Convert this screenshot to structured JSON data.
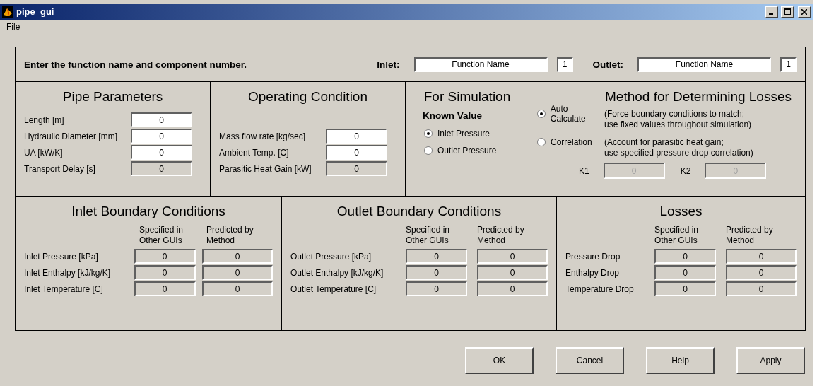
{
  "window": {
    "title": "pipe_gui"
  },
  "menu": [
    "File"
  ],
  "header": {
    "prompt": "Enter the function name and component number.",
    "ports": [
      {
        "label": "Inlet:",
        "function": "Function Name",
        "number": "1"
      },
      {
        "label": "Outlet:",
        "function": "Function Name",
        "number": "1"
      }
    ]
  },
  "pipe_parameters": {
    "title": "Pipe Parameters",
    "fields": [
      {
        "label": "Length [m]",
        "value": "0",
        "kind": "editable"
      },
      {
        "label": "Hydraulic Diameter [mm]",
        "value": "0",
        "kind": "editable"
      },
      {
        "label": "UA [kW/K]",
        "value": "0",
        "kind": "editable"
      },
      {
        "label": "Transport Delay [s]",
        "value": "0",
        "kind": "readonly"
      }
    ]
  },
  "operating_condition": {
    "title": "Operating Condition",
    "fields": [
      {
        "label": "Mass flow rate [kg/sec]",
        "value": "0",
        "kind": "editable"
      },
      {
        "label": "Ambient Temp. [C]",
        "value": "0",
        "kind": "editable"
      },
      {
        "label": "Parasitic Heat Gain [kW]",
        "value": "0",
        "kind": "readonly"
      }
    ]
  },
  "for_simulation": {
    "title": "For Simulation",
    "subtitle": "Known Value",
    "options": [
      {
        "label": "Inlet Pressure",
        "selected": true
      },
      {
        "label": "Outlet Pressure",
        "selected": false
      }
    ]
  },
  "method": {
    "title": "Method for Determining Losses",
    "options": [
      {
        "label": "Auto Calculate",
        "selected": true,
        "note": [
          "(Force boundary conditions to match;",
          "use fixed values throughout simulation)"
        ]
      },
      {
        "label": "Correlation",
        "selected": false,
        "note": [
          "(Account for parasitic heat gain;",
          "use specified pressure drop correlation)"
        ]
      }
    ],
    "coefficients": [
      {
        "label": "K1",
        "value": "0",
        "kind": "disabled"
      },
      {
        "label": "K2",
        "value": "0",
        "kind": "disabled"
      }
    ]
  },
  "boundary_sections": [
    {
      "title": "Inlet Boundary Conditions",
      "columns": [
        [
          "Specified in",
          "Other GUIs"
        ],
        [
          "Predicted by",
          "Method"
        ]
      ],
      "rows": [
        {
          "label": "Inlet Pressure [kPa]",
          "values": [
            {
              "value": "0",
              "kind": "readonly"
            },
            {
              "value": "0",
              "kind": "readonly"
            }
          ]
        },
        {
          "label": "Inlet Enthalpy [kJ/kg/K]",
          "values": [
            {
              "value": "0",
              "kind": "readonly"
            },
            {
              "value": "0",
              "kind": "readonly"
            }
          ]
        },
        {
          "label": "Inlet Temperature [C]",
          "values": [
            {
              "value": "0",
              "kind": "readonly"
            },
            {
              "value": "0",
              "kind": "readonly"
            }
          ]
        }
      ]
    },
    {
      "title": "Outlet Boundary Conditions",
      "columns": [
        [
          "Specified in",
          "Other GUIs"
        ],
        [
          "Predicted by",
          "Method"
        ]
      ],
      "rows": [
        {
          "label": "Outlet Pressure [kPa]",
          "values": [
            {
              "value": "0",
              "kind": "readonly"
            },
            {
              "value": "0",
              "kind": "readonly"
            }
          ]
        },
        {
          "label": "Outlet Enthalpy [kJ/kg/K]",
          "values": [
            {
              "value": "0",
              "kind": "readonly"
            },
            {
              "value": "0",
              "kind": "readonly"
            }
          ]
        },
        {
          "label": "Outlet Temperature [C]",
          "values": [
            {
              "value": "0",
              "kind": "readonly"
            },
            {
              "value": "0",
              "kind": "readonly"
            }
          ]
        }
      ]
    },
    {
      "title": "Losses",
      "columns": [
        [
          "Specified in",
          "Other GUIs"
        ],
        [
          "Predicted by",
          "Method"
        ]
      ],
      "rows": [
        {
          "label": "Pressure Drop",
          "values": [
            {
              "value": "0",
              "kind": "readonly"
            },
            {
              "value": "0",
              "kind": "readonly"
            }
          ]
        },
        {
          "label": "Enthalpy Drop",
          "values": [
            {
              "value": "0",
              "kind": "readonly"
            },
            {
              "value": "0",
              "kind": "readonly"
            }
          ]
        },
        {
          "label": "Temperature Drop",
          "values": [
            {
              "value": "0",
              "kind": "readonly"
            },
            {
              "value": "0",
              "kind": "readonly"
            }
          ]
        }
      ]
    }
  ],
  "buttons": [
    "OK",
    "Cancel",
    "Help",
    "Apply"
  ]
}
